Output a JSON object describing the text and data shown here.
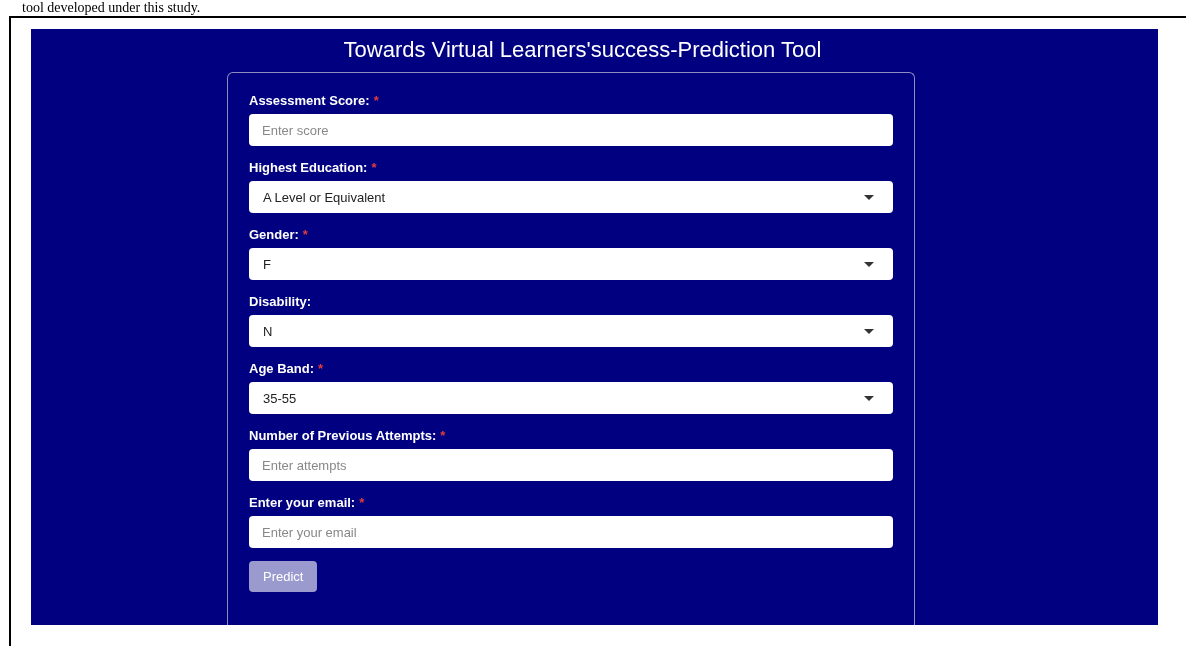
{
  "caption": "tool developed under this study.",
  "app": {
    "title": "Towards Virtual Learners'success-Prediction Tool"
  },
  "form": {
    "fields": [
      {
        "kind": "text",
        "label": "Assessment Score:",
        "required_mark": "*",
        "placeholder": "Enter score"
      },
      {
        "kind": "select",
        "label": "Highest Education:",
        "required_mark": "*",
        "value": "A Level or Equivalent"
      },
      {
        "kind": "select",
        "label": "Gender:",
        "required_mark": "*",
        "value": "F"
      },
      {
        "kind": "select",
        "label": "Disability:",
        "value": "N"
      },
      {
        "kind": "select",
        "label": "Age Band:",
        "required_mark": "*",
        "value": "35-55"
      },
      {
        "kind": "text",
        "label": "Number of Previous Attempts:",
        "required_mark": "*",
        "placeholder": "Enter attempts"
      },
      {
        "kind": "text",
        "label": "Enter your email:",
        "required_mark": "*",
        "placeholder": "Enter your email"
      }
    ],
    "button": {
      "label": "Predict",
      "disabled": true
    }
  }
}
